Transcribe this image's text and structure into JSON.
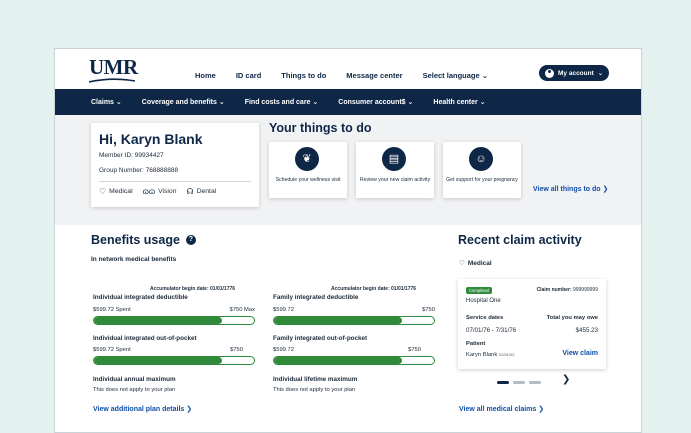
{
  "header": {
    "logo": "UMR",
    "nav": [
      "Home",
      "ID card",
      "Things to do",
      "Message center",
      "Select language"
    ],
    "account_label": "My account"
  },
  "mainnav": [
    "Claims",
    "Coverage and benefits",
    "Find costs and care",
    "Consumer account$",
    "Health center"
  ],
  "profile": {
    "greeting": "Hi, Karyn Blank",
    "member_id": "Member ID: 99934427",
    "group_number": "Group Number: 768888888",
    "coverage": [
      "Medical",
      "Vision",
      "Dental"
    ]
  },
  "things": {
    "title": "Your things to do",
    "cards": [
      "Schedule your wellness visit",
      "Review your new claim activity",
      "Get support for your pregnancy"
    ],
    "view_all": "View all things to do"
  },
  "benefits": {
    "title": "Benefits usage",
    "subtitle": "In network medical benefits",
    "accumulator_left": "Accumulator begin date: 01/01/1776",
    "accumulator_right": "Accumulator begin date: 01/01/1776",
    "items": [
      {
        "title": "Individual integrated deductible",
        "spent": "$599.72 Spent",
        "max": "$750 Max",
        "fraction": 0.8
      },
      {
        "title": "Family integrated deductible",
        "spent": "$599.72",
        "max": "$750",
        "fraction": 0.8
      },
      {
        "title": "Individual integrated out-of-pocket",
        "spent": "$599.72 Spent",
        "max": "$750",
        "fraction": 0.8
      },
      {
        "title": "Family integrated out-of-pocket",
        "spent": "$599.72",
        "max": "$750",
        "fraction": 0.8
      }
    ],
    "annual_max_title": "Individual annual maximum",
    "annual_max_note": "This does not apply to your plan",
    "lifetime_max_title": "Individual lifetime maximum",
    "lifetime_max_note": "This does not apply to your plan",
    "additional_link": "View additional plan details"
  },
  "claims": {
    "title": "Recent claim activity",
    "category": "Medical",
    "card": {
      "status": "Completed",
      "claim_label": "Claim number:",
      "claim_number": "999999999",
      "provider": "Hospital One",
      "service_dates_label": "Service dates",
      "service_dates": "07/01/76 - 7/31/76",
      "owe_label": "Total you may owe",
      "owe": "$455.23",
      "patient_label": "Patient",
      "patient": "Karyn Blank",
      "patient_dob": "01/01/02",
      "view": "View claim"
    },
    "view_all": "View all medical claims"
  },
  "colors": {
    "navy": "#0f2746",
    "green": "#2f8a3a",
    "link": "#0f4fa8",
    "bg": "#e3f1ef"
  }
}
